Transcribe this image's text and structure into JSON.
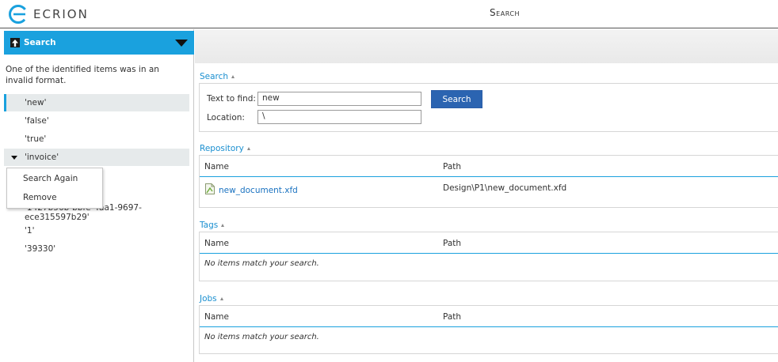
{
  "header": {
    "logo_text": "ECRION",
    "title": "Search"
  },
  "left_panel": {
    "title": "Search",
    "message": "One of the identified items was in an invalid format.",
    "items": [
      {
        "label": "'new'"
      },
      {
        "label": "'false'"
      },
      {
        "label": "'true'"
      },
      {
        "label": "'invoice'"
      },
      {
        "label": "'1427b56b-bbfe-4aa1-9697-ece315597b29'"
      },
      {
        "label": "'1'"
      },
      {
        "label": "'39330'"
      }
    ],
    "context_menu": {
      "items": [
        {
          "label": "Search Again"
        },
        {
          "label": "Remove"
        }
      ]
    }
  },
  "search_section": {
    "title": "Search",
    "text_to_find_label": "Text to find:",
    "text_to_find_value": "new",
    "location_label": "Location:",
    "location_value": "\\",
    "button_label": "Search"
  },
  "repository": {
    "title": "Repository",
    "columns": [
      "Name",
      "Path"
    ],
    "rows": [
      {
        "name": "new_document.xfd",
        "path": "Design\\P1\\new_document.xfd"
      }
    ]
  },
  "tags": {
    "title": "Tags",
    "columns": [
      "Name",
      "Path"
    ],
    "empty_text": "No items match your search."
  },
  "jobs": {
    "title": "Jobs",
    "columns": [
      "Name",
      "Path"
    ],
    "empty_text": "No items match your search."
  },
  "colors": {
    "accent": "#1aa1de",
    "button": "#2b64b1",
    "link": "#1a72c0",
    "selected_bg": "#e6eaeb"
  }
}
